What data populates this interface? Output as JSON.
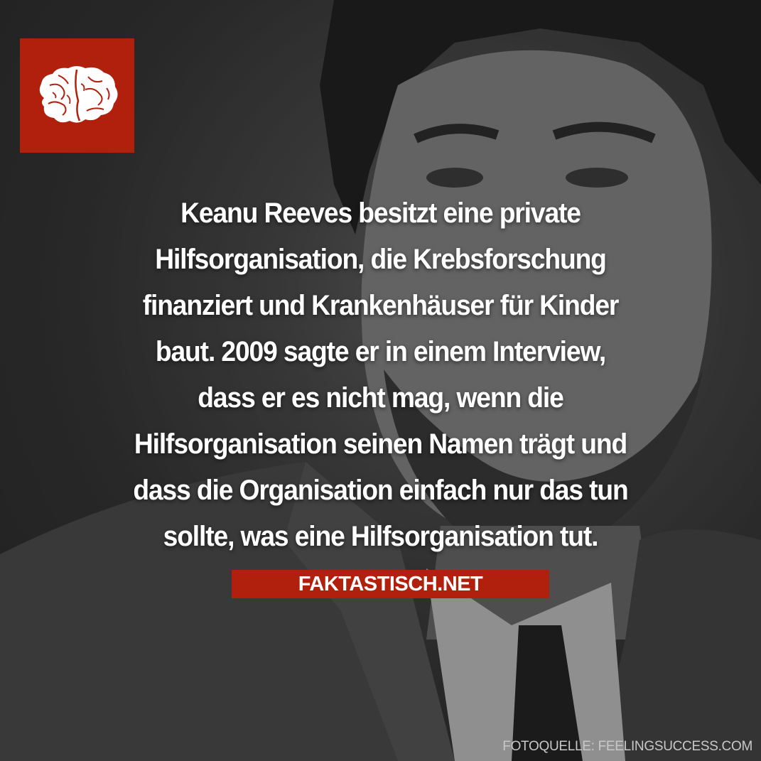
{
  "logo": {
    "icon": "brain-icon",
    "background_color": "#b0200c"
  },
  "fact": {
    "lines": [
      "Keanu Reeves besitzt eine private",
      "Hilfsorganisation, die Krebsforschung",
      "finanziert und Krankenhäuser für Kinder",
      "baut. 2009 sagte er in einem Interview,",
      "dass er es nicht mag, wenn die",
      "Hilfsorganisation seinen Namen trägt und",
      "dass die Organisation einfach nur das tun",
      "sollte, was eine Hilfsorganisation tut."
    ]
  },
  "brand": {
    "label": "FAKTASTISCH.NET",
    "color": "#b0200c"
  },
  "credit": {
    "text": "FOTOQUELLE: FEELINGSUCCESS.COM"
  }
}
